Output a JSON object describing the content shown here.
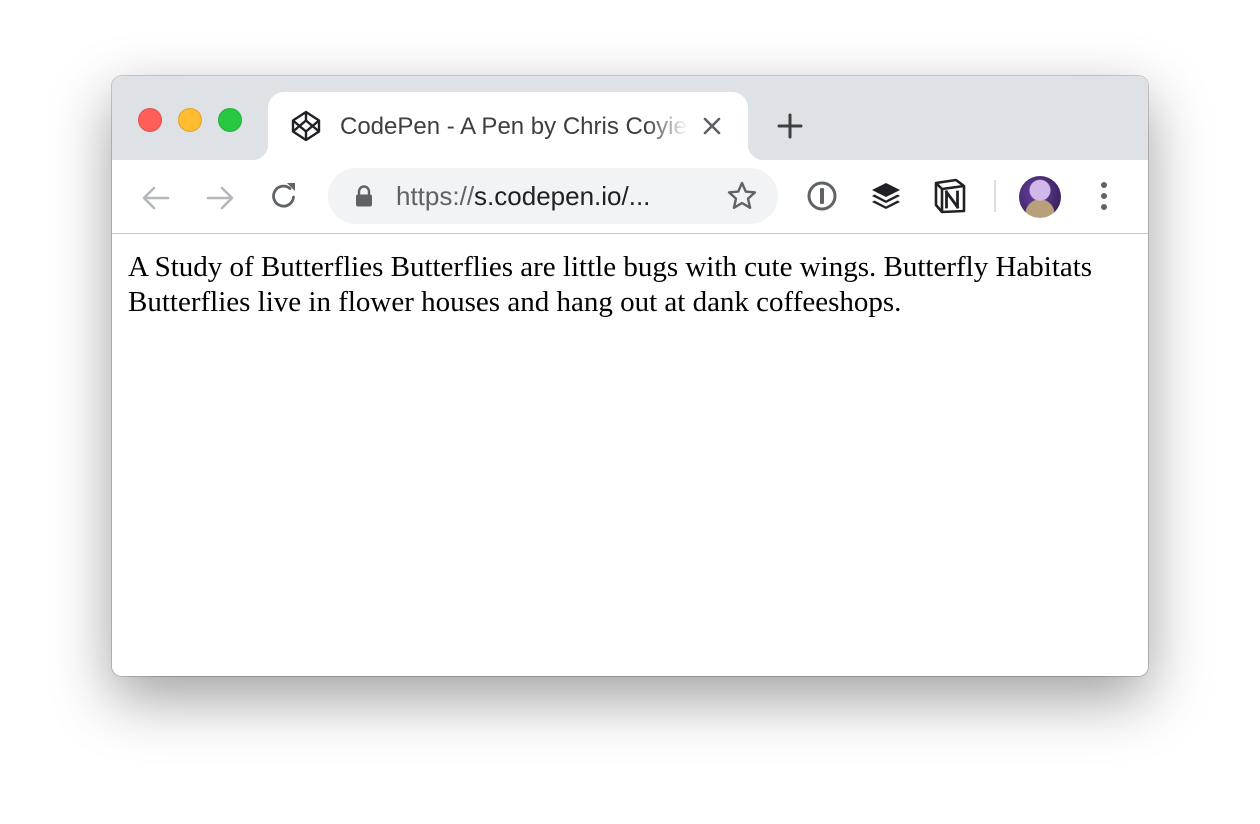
{
  "window": {
    "controls": [
      "close",
      "minimize",
      "zoom"
    ],
    "colors": {
      "close": "#ff5f57",
      "minimize": "#febc2e",
      "zoom": "#28c840",
      "tabbar": "#dee1e6"
    }
  },
  "tab": {
    "title": "CodePen - A Pen by Chris Coyier",
    "favicon": "codepen-logo-icon",
    "close_icon": "close-icon"
  },
  "new_tab_icon": "plus-icon",
  "toolbar": {
    "back_icon": "arrow-left-icon",
    "forward_icon": "arrow-right-icon",
    "reload_icon": "reload-icon",
    "address": {
      "lock_icon": "lock-icon",
      "scheme": "https://",
      "host_path": "s.codepen.io/...",
      "bookmark_icon": "star-icon"
    },
    "extensions": [
      "1password-icon",
      "buffer-icon",
      "notion-icon"
    ],
    "profile_avatar": "avatar",
    "menu_icon": "more-vertical-icon"
  },
  "page": {
    "text": "A Study of Butterflies Butterflies are little bugs with cute wings. Butterfly Habitats Butterflies live in flower houses and hang out at dank coffeeshops."
  }
}
